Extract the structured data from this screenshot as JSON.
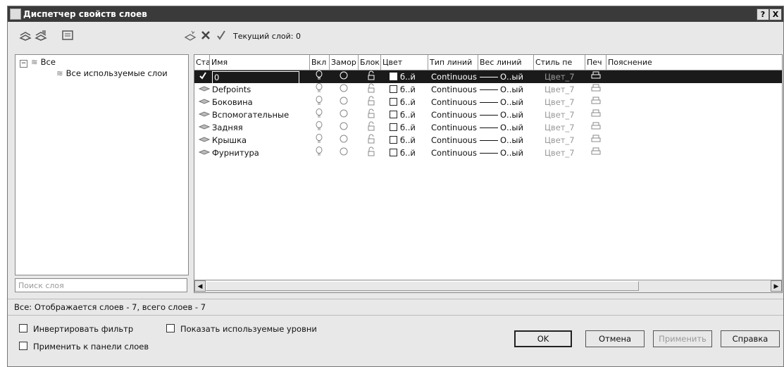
{
  "window": {
    "title": "Диспетчер свойств слоев",
    "help_btn": "?",
    "close_btn": "X"
  },
  "toolbar": {
    "current_layer": "Текущий слой: 0"
  },
  "tree": {
    "root": "Все",
    "child": "Все используемые слои"
  },
  "search": {
    "placeholder": "Поиск слоя"
  },
  "columns": [
    "Ста",
    "Имя",
    "Вкл",
    "Замор",
    "Блок",
    "Цвет",
    "Тип линий",
    "Вес линий",
    "Стиль пе",
    "Печ",
    "Пояснение"
  ],
  "layers": [
    {
      "name": "0",
      "color": "б..й",
      "linetype": "Continuous",
      "weight": "О..ый",
      "style": "Цвет_7"
    },
    {
      "name": "Defpoints",
      "color": "б..й",
      "linetype": "Continuous",
      "weight": "О..ый",
      "style": "Цвет_7"
    },
    {
      "name": "Боковина",
      "color": "б..й",
      "linetype": "Continuous",
      "weight": "О..ый",
      "style": "Цвет_7"
    },
    {
      "name": "Вспомогательные",
      "color": "б..й",
      "linetype": "Continuous",
      "weight": "О..ый",
      "style": "Цвет_7"
    },
    {
      "name": "Задняя",
      "color": "б..й",
      "linetype": "Continuous",
      "weight": "О..ый",
      "style": "Цвет_7"
    },
    {
      "name": "Крышка",
      "color": "б..й",
      "linetype": "Continuous",
      "weight": "О..ый",
      "style": "Цвет_7"
    },
    {
      "name": "Фурнитура",
      "color": "б..й",
      "linetype": "Continuous",
      "weight": "О..ый",
      "style": "Цвет_7"
    }
  ],
  "status": "Все: Отображается слоев - 7, всего слоев - 7",
  "options": {
    "invert_filter": "Инвертировать фильтр",
    "show_used": "Показать используемые уровни",
    "apply_to_panel": "Применить к панели слоев"
  },
  "buttons": {
    "ok": "OK",
    "cancel": "Отмена",
    "apply": "Применить",
    "help": "Справка"
  }
}
